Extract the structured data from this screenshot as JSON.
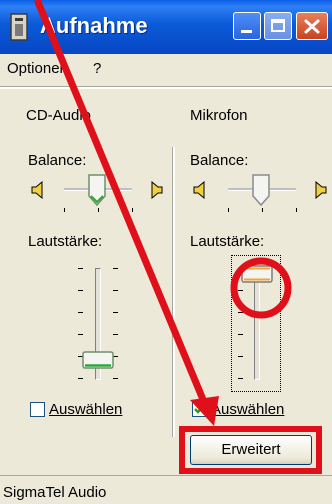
{
  "window": {
    "title": "Aufnahme",
    "colors": {
      "titlebar": "#0a5ad8",
      "close": "#c8421e",
      "annotation": "#e0101a"
    }
  },
  "menu": [
    {
      "label": "Optionen"
    },
    {
      "label": "?"
    }
  ],
  "channels": [
    {
      "name": "CD-Audio",
      "balance_label": "Balance:",
      "volume_label": "Lautstärke:",
      "checkbox_label": "Auswählen",
      "selected": false,
      "volume_level": 0.15,
      "balance_level": 0.6
    },
    {
      "name": "Mikrofon",
      "balance_label": "Balance:",
      "volume_label": "Lautstärke:",
      "checkbox_label": "Auswählen",
      "selected": true,
      "volume_level": 0.9,
      "balance_level": 0.5
    }
  ],
  "advanced_button": {
    "label": "Erweitert"
  },
  "status": {
    "text": "SigmaTel Audio"
  },
  "icons": [
    "app-icon",
    "minimize-icon",
    "maximize-icon",
    "close-icon",
    "speaker-left-icon",
    "speaker-right-icon",
    "checkmark-icon"
  ]
}
